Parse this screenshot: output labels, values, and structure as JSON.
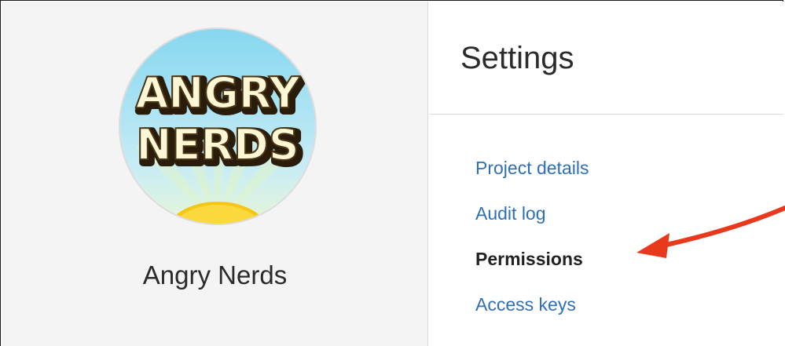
{
  "project": {
    "name": "Angry Nerds",
    "logo_text_line1": "ANGRY",
    "logo_text_line2": "NERDS"
  },
  "settings": {
    "title": "Settings",
    "nav": [
      {
        "label": "Project details",
        "active": false
      },
      {
        "label": "Audit log",
        "active": false
      },
      {
        "label": "Permissions",
        "active": true
      },
      {
        "label": "Access keys",
        "active": false
      }
    ]
  },
  "annotation": {
    "arrow_icon": "red-arrow-icon",
    "color": "#e8391d"
  },
  "colors": {
    "link": "#2f6fb5",
    "sidebar_bg": "#f4f4f4"
  }
}
